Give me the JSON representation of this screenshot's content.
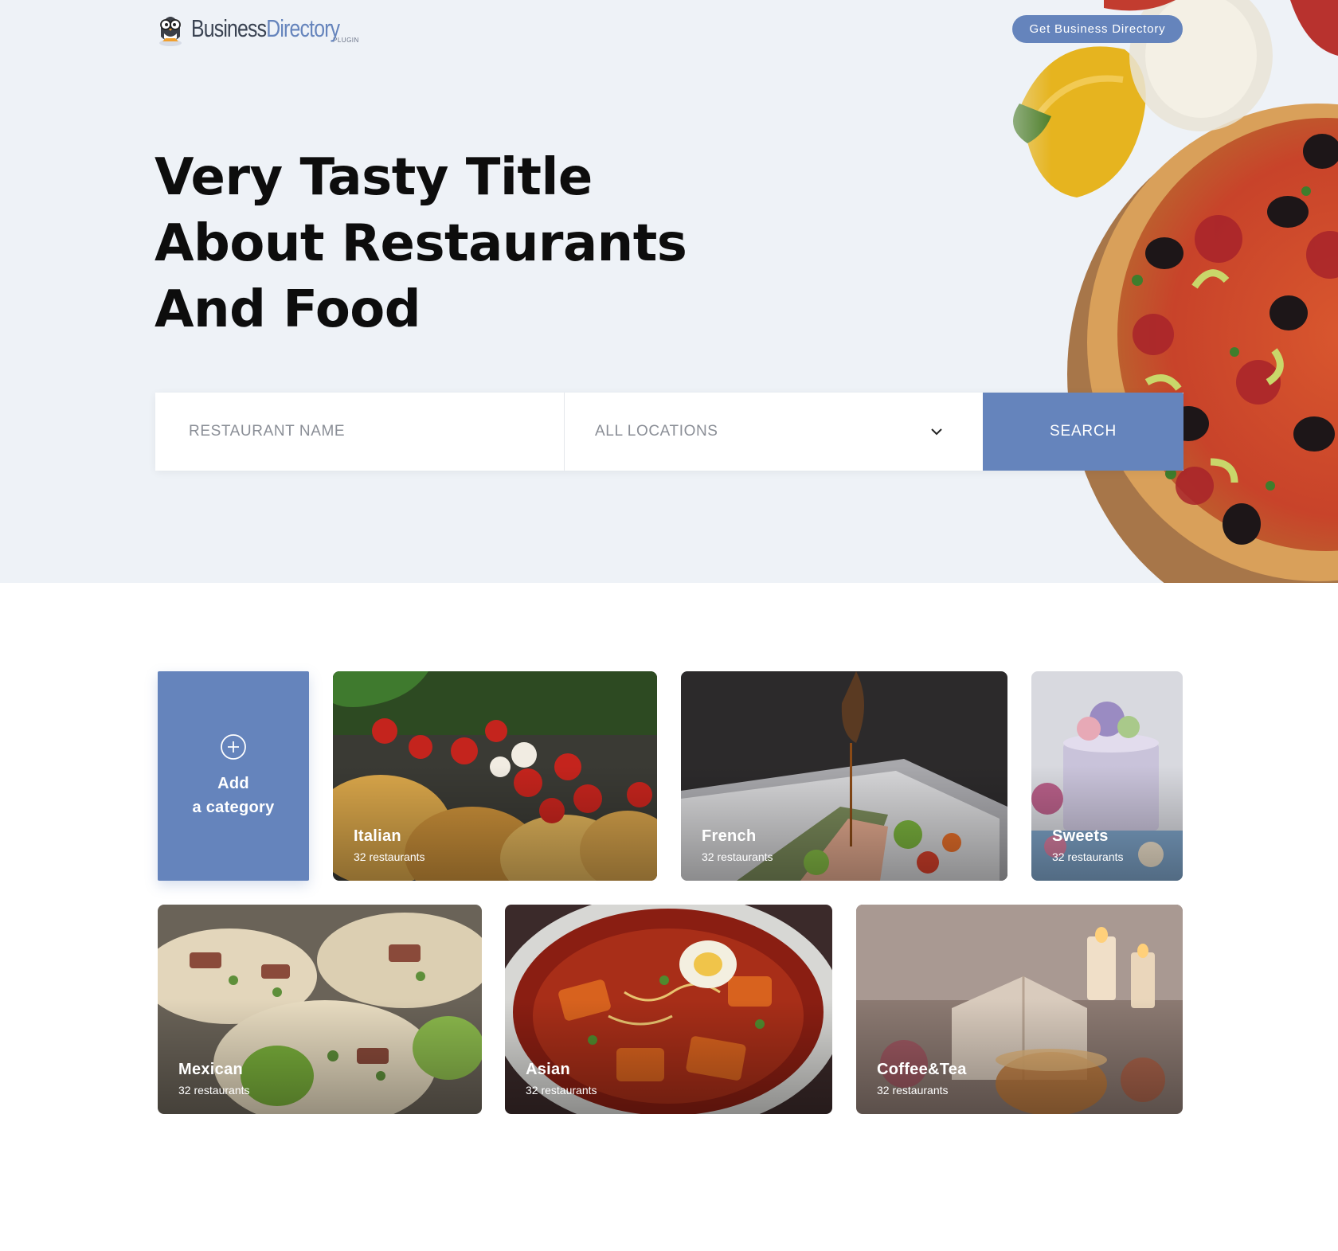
{
  "brand": {
    "logo_text_primary": "Business",
    "logo_text_secondary": "Directory",
    "logo_sub": "PLUGIN",
    "accent": "#6584bc"
  },
  "header": {
    "cta_label": "Get Business Directory"
  },
  "hero": {
    "title_lines": [
      "Very Tasty Title",
      "About Restaurants",
      "And Food"
    ]
  },
  "search": {
    "name_placeholder": "RESTAURANT NAME",
    "location_value": "ALL LOCATIONS",
    "button_label": "SEARCH"
  },
  "add_category": {
    "line1": "Add",
    "line2": "a category",
    "icon": "plus-circle-icon"
  },
  "categories": [
    {
      "name": "Italian",
      "count": "32 restaurants"
    },
    {
      "name": "French",
      "count": "32 restaurants"
    },
    {
      "name": "Sweets",
      "count": "32 restaurants"
    },
    {
      "name": "Mexican",
      "count": "32 restaurants"
    },
    {
      "name": "Asian",
      "count": "32 restaurants"
    },
    {
      "name": "Coffee&Tea",
      "count": "32 restaurants"
    }
  ]
}
